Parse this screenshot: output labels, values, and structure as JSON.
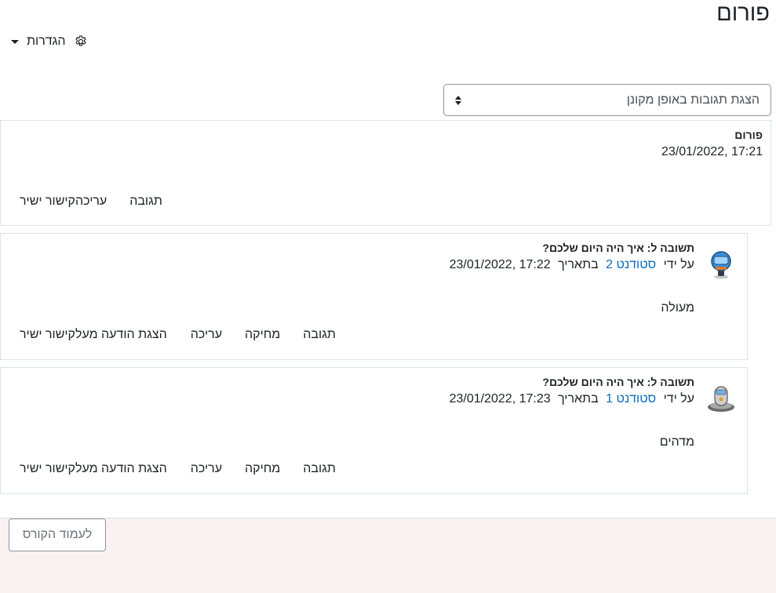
{
  "page": {
    "title": "פורום"
  },
  "settings": {
    "label": "הגדרות",
    "icon": "gear-icon"
  },
  "display_mode": {
    "selected": "הצגת תגובות באופן מקונן"
  },
  "posts": [
    {
      "subject": "פורום",
      "date": "17:21 ,23/01/2022",
      "actions": [
        "קישור ישיר",
        "עריכה",
        "תגובה"
      ]
    },
    {
      "subject": "תשובה ל: איך היה היום שלכם?",
      "by_prefix": "על ידי",
      "author": "סטודנט 2",
      "date_prefix": "בתאריך",
      "date": "17:22 ,23/01/2022",
      "content": "מעולה",
      "avatar": "robot-avatar-blue",
      "actions": [
        "קישור ישיר",
        "הצגת הודעה מעל",
        "עריכה",
        "מחיקה",
        "תגובה"
      ]
    },
    {
      "subject": "תשובה ל: איך היה היום שלכם?",
      "by_prefix": "על ידי",
      "author": "סטודנט 1",
      "date_prefix": "בתאריך",
      "date": "17:23 ,23/01/2022",
      "content": "מדהים",
      "avatar": "robot-avatar-grey",
      "actions": [
        "קישור ישיר",
        "הצגת הודעה מעל",
        "עריכה",
        "מחיקה",
        "תגובה"
      ]
    }
  ],
  "footer": {
    "back_label": "לעמוד הקורס"
  },
  "colors": {
    "link": "#0f6cbf",
    "footer_bg": "#f8f3f0",
    "border": "#dee2e6"
  }
}
